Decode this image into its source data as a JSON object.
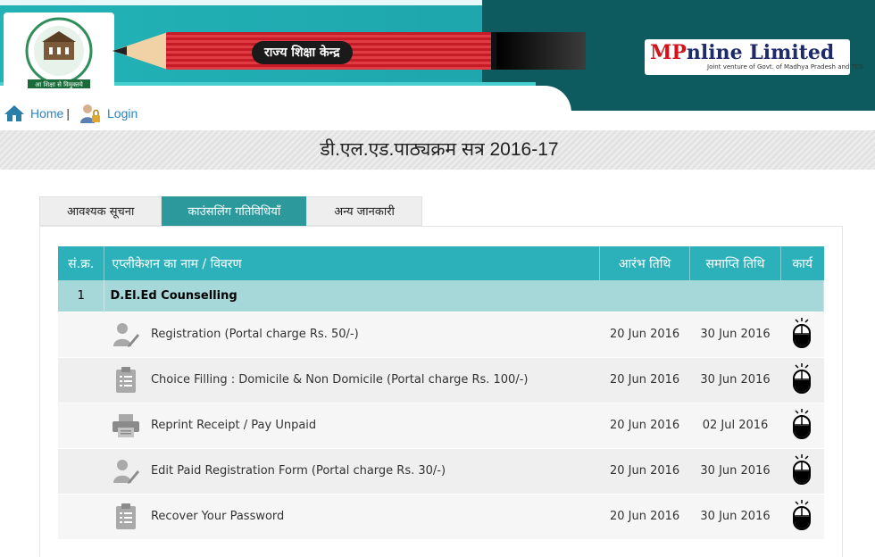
{
  "banner": {
    "center_label": "राज्य शिक्षा केन्द्र",
    "logo_tagline": "आ शिक्षा से विमुक्तये",
    "mp_title_red": "MP",
    "mp_title_rest": "nline Limited",
    "mp_subtitle": "Joint venture of Govt. of Madhya Pradesh and TCS"
  },
  "nav": {
    "home_label": "Home",
    "separator": "|",
    "login_label": "Login"
  },
  "page_title": "डी.एल.एड.पाठ्यक्रम सत्र 2016-17",
  "tabs": [
    {
      "label": "आवश्यक सूचना",
      "active": false
    },
    {
      "label": "काउंसलिंग गतिविधियाँ",
      "active": true
    },
    {
      "label": "अन्य जानकारी",
      "active": false
    }
  ],
  "table": {
    "headers": {
      "sn": "सं.क्र.",
      "app": "एप्लीकेशन का नाम / विवरण",
      "start": "आरंभ तिथि",
      "end": "समाप्ति तिथि",
      "action": "कार्य"
    },
    "group": {
      "sn": "1",
      "name": "D.El.Ed Counselling"
    },
    "rows": [
      {
        "icon": "user-edit-icon",
        "name": "Registration (Portal charge Rs. 50/-)",
        "start": "20 Jun 2016",
        "end": "30 Jun 2016"
      },
      {
        "icon": "clipboard-icon",
        "name": "Choice Filling : Domicile & Non Domicile (Portal charge Rs. 100/-)",
        "start": "20 Jun 2016",
        "end": "30 Jun 2016"
      },
      {
        "icon": "printer-icon",
        "name": "Reprint Receipt / Pay Unpaid",
        "start": "20 Jun 2016",
        "end": "02 Jul 2016"
      },
      {
        "icon": "user-edit-icon",
        "name": "Edit Paid Registration Form (Portal charge Rs. 30/-)",
        "start": "20 Jun 2016",
        "end": "30 Jun 2016"
      },
      {
        "icon": "clipboard-icon",
        "name": "Recover Your Password",
        "start": "20 Jun 2016",
        "end": "30 Jun 2016"
      }
    ]
  },
  "colors": {
    "banner_teal": "#22b3b7",
    "table_header": "#2cb1ba",
    "group_row": "#a6d7d9",
    "active_tab": "#2c9a9d",
    "link_blue": "#2a84c8"
  }
}
